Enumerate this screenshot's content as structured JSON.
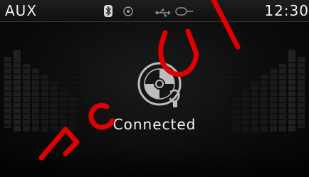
{
  "header": {
    "source_label": "AUX",
    "clock": "12:30",
    "icons": [
      "bluetooth-icon",
      "disc-icon",
      "usb-icon",
      "aux-cable-icon"
    ]
  },
  "main": {
    "status_text": "Connected",
    "center_icon": "aux-disc-icon"
  },
  "colors": {
    "background": "#0c0c0c",
    "text": "#eaeaea",
    "watermark": "#e00000"
  },
  "watermark": {
    "letters": [
      "E",
      "C",
      "U",
      "I"
    ]
  }
}
